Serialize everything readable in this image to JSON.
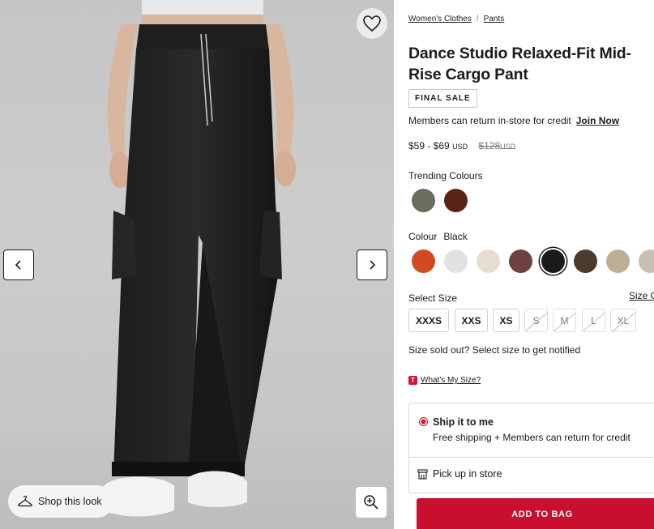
{
  "breadcrumb": [
    {
      "label": "Women's Clothes"
    },
    {
      "label": "Pants"
    }
  ],
  "breadcrumb_separator": "/",
  "product": {
    "title": "Dance Studio Relaxed-Fit Mid-Rise Cargo Pant",
    "badge": "FINAL SALE",
    "members_text": "Members can return in-store for credit",
    "join_label": "Join Now",
    "price_range": "$59 - $69",
    "currency": "USD",
    "original_price": "$128",
    "original_currency": "USD"
  },
  "trending": {
    "label": "Trending Colours",
    "swatches": [
      {
        "name": "trending-olive",
        "color": "#6b6b5e"
      },
      {
        "name": "trending-brown",
        "color": "#5a2318"
      }
    ]
  },
  "colour": {
    "label": "Colour",
    "selected": "Black",
    "swatches": [
      {
        "name": "orange",
        "color": "#d24a24",
        "selected": false
      },
      {
        "name": "light-grey",
        "color": "#e2e2e4",
        "selected": false
      },
      {
        "name": "cream",
        "color": "#e6ddd2",
        "selected": false
      },
      {
        "name": "mauve-brown",
        "color": "#6d4140",
        "selected": false
      },
      {
        "name": "black",
        "color": "#1a1a1a",
        "selected": true
      },
      {
        "name": "espresso",
        "color": "#4c3a2c",
        "selected": false
      },
      {
        "name": "khaki",
        "color": "#bfae94",
        "selected": false
      },
      {
        "name": "sand",
        "color": "#c9bfb1",
        "selected": false
      }
    ]
  },
  "size": {
    "label": "Select Size",
    "guide_label": "Size G",
    "options": [
      {
        "label": "XXXS",
        "available": true
      },
      {
        "label": "XXS",
        "available": true
      },
      {
        "label": "XS",
        "available": true
      },
      {
        "label": "S",
        "available": false
      },
      {
        "label": "M",
        "available": false
      },
      {
        "label": "L",
        "available": false
      },
      {
        "label": "XL",
        "available": false
      }
    ],
    "sold_out_text": "Size sold out? Select size to get notified",
    "whats_my_size_icon": "T",
    "whats_my_size": "What's My Size?"
  },
  "fulfillment": {
    "ship_title": "Ship it to me",
    "ship_sub": "Free shipping + Members can return for credit",
    "pickup_label": "Pick up in store"
  },
  "cta": {
    "add_to_bag": "ADD TO BAG"
  },
  "gallery": {
    "shop_look": "Shop this look",
    "icons": {
      "favorite": "heart-icon",
      "prev": "chevron-left-icon",
      "next": "chevron-right-icon",
      "shop_look": "hanger-icon",
      "zoom": "zoom-in-icon",
      "pickup": "store-icon"
    }
  },
  "colors": {
    "accent": "#c8102e",
    "radio": "#d31334"
  }
}
